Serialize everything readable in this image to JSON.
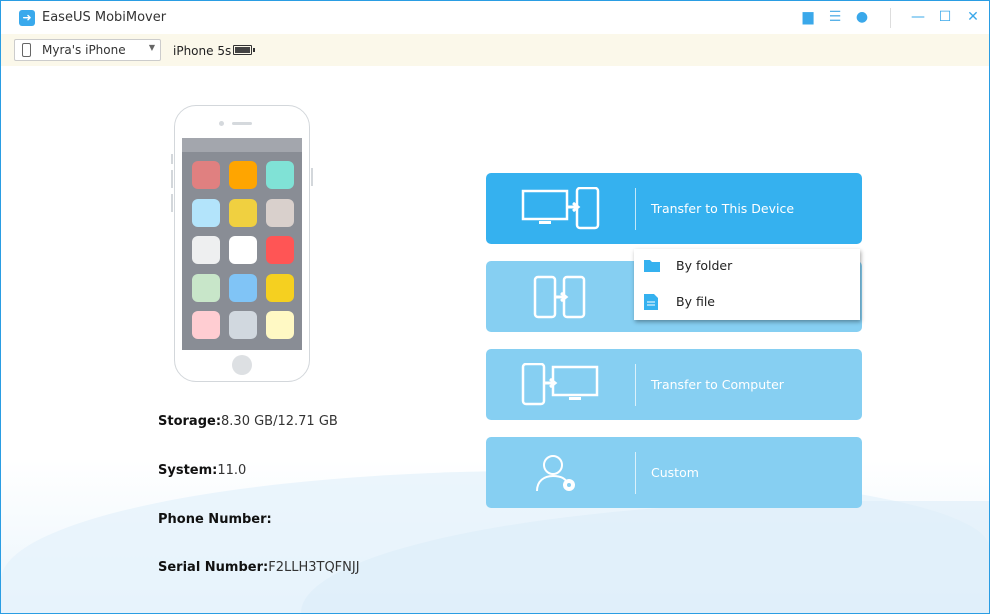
{
  "app": {
    "title": "EaseUS MobiMover"
  },
  "titlebar": {
    "icons": [
      "feedback-icon",
      "menu-icon",
      "globe-icon",
      "minimize-icon",
      "maximize-icon",
      "close-icon"
    ]
  },
  "device": {
    "name": "Myra's iPhone",
    "model": "iPhone 5s",
    "battery_level": 1.0
  },
  "phone": {
    "app_colors": [
      "#e08080",
      "#ffa500",
      "#80e2d6",
      "#b3e4fb",
      "#f0d040",
      "#d9d0cc",
      "#eeeff0",
      "#ffffff",
      "#ff5555",
      "#c8e6c9",
      "#80c4f6",
      "#f5d020",
      "#ffcdd2",
      "#d1d8df",
      "#fff9c4"
    ]
  },
  "info": {
    "storage_label": "Storage:",
    "storage_value": "8.30 GB/12.71 GB",
    "system_label": "System:",
    "system_value": "11.0",
    "phone_label": "Phone Number:",
    "phone_value": "",
    "serial_label": "Serial Number:",
    "serial_value": "F2LLH3TQFNJJ"
  },
  "actions": [
    {
      "label": "Transfer to This Device"
    },
    {
      "label": ""
    },
    {
      "label": "Transfer to Computer"
    },
    {
      "label": "Custom"
    }
  ],
  "menu": {
    "items": [
      {
        "label": "By folder"
      },
      {
        "label": "By file"
      }
    ]
  },
  "colors": {
    "accent": "#35b1ef",
    "card": "#86cff2",
    "devbar": "#fbf8ea"
  }
}
